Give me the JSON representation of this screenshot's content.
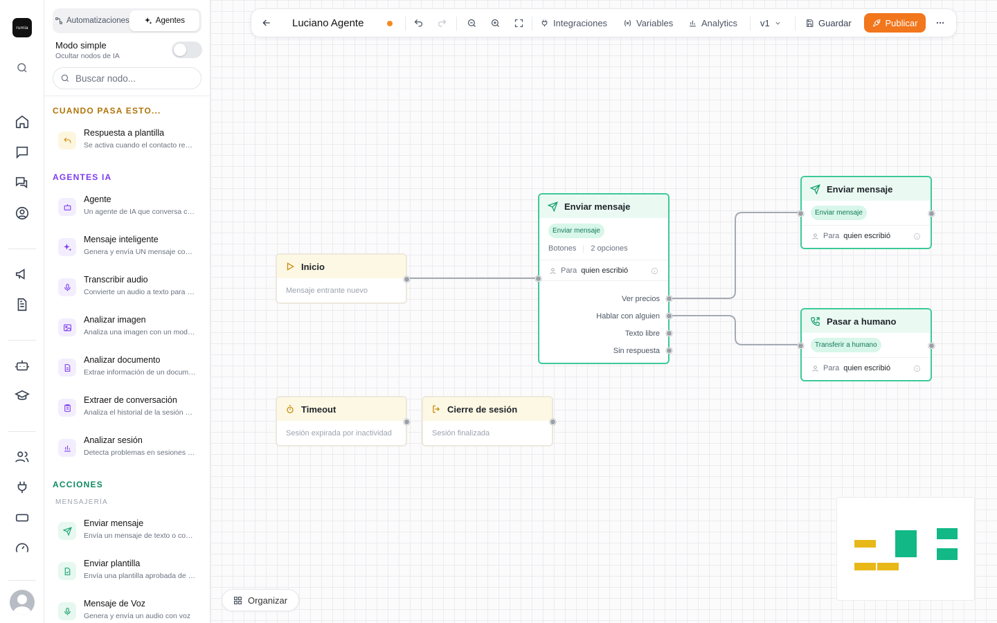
{
  "brand": {
    "logo_text": "rumia"
  },
  "sidebar": {
    "tabs": [
      {
        "label": "Automatizaciones"
      },
      {
        "label": "Agentes"
      }
    ],
    "simple_mode": {
      "title": "Modo simple",
      "subtitle": "Ocultar nodos de IA",
      "enabled": false
    },
    "search": {
      "placeholder": "Buscar nodo..."
    },
    "sections": {
      "triggers": {
        "title": "CUANDO PASA ESTO...",
        "items": [
          {
            "title": "Respuesta a plantilla",
            "desc": "Se activa cuando el contacto responde a una plantilla"
          }
        ]
      },
      "ai_agents": {
        "title": "AGENTES IA",
        "items": [
          {
            "title": "Agente",
            "desc": "Un agente de IA que conversa con el contacto"
          },
          {
            "title": "Mensaje inteligente",
            "desc": "Genera y envía UN mensaje con IA"
          },
          {
            "title": "Transcribir audio",
            "desc": "Convierte un audio a texto para procesarlo"
          },
          {
            "title": "Analizar imagen",
            "desc": "Analiza una imagen con un modelo de IA"
          },
          {
            "title": "Analizar documento",
            "desc": "Extrae información de un documento"
          },
          {
            "title": "Extraer de conversación",
            "desc": "Analiza el historial de la sesión y extrae datos"
          },
          {
            "title": "Analizar sesión",
            "desc": "Detecta problemas en sesiones anteriores"
          }
        ]
      },
      "actions": {
        "title": "ACCIONES",
        "subsection": "MENSAJERÍA",
        "items": [
          {
            "title": "Enviar mensaje",
            "desc": "Envía un mensaje de texto o contenido"
          },
          {
            "title": "Enviar plantilla",
            "desc": "Envía una plantilla aprobada de WhatsApp"
          },
          {
            "title": "Mensaje de Voz",
            "desc": "Genera y envía un audio con voz"
          }
        ]
      }
    }
  },
  "toolbar": {
    "title": "Luciano Agente",
    "integrations": "Integraciones",
    "variables": "Variables",
    "analytics": "Analytics",
    "version": "v1",
    "save": "Guardar",
    "publish": "Publicar"
  },
  "nodes": {
    "inicio": {
      "title": "Inicio",
      "subtitle": "Mensaje entrante nuevo"
    },
    "timeout": {
      "title": "Timeout",
      "subtitle": "Sesión expirada por inactividad"
    },
    "cierre": {
      "title": "Cierre de sesión",
      "subtitle": "Sesión finalizada"
    },
    "send_main": {
      "title": "Enviar mensaje",
      "pill": "Enviar mensaje",
      "buttons_label": "Botones",
      "buttons_value": "2 opciones",
      "to_prefix": "Para",
      "to_value": "quien escribió",
      "outputs": [
        "Ver precios",
        "Hablar con alguien",
        "Texto libre",
        "Sin respuesta"
      ]
    },
    "send_top": {
      "title": "Enviar mensaje",
      "pill": "Enviar mensaje",
      "to_prefix": "Para",
      "to_value": "quien escribió"
    },
    "human": {
      "title": "Pasar a humano",
      "pill": "Transferir a humano",
      "to_prefix": "Para",
      "to_value": "quien escribió"
    }
  },
  "canvas": {
    "organize": "Organizar"
  },
  "colors": {
    "accent": "#f2761c",
    "green": "#3cc998",
    "yellow": "#e8b818",
    "minimap_green": "#12b886"
  }
}
